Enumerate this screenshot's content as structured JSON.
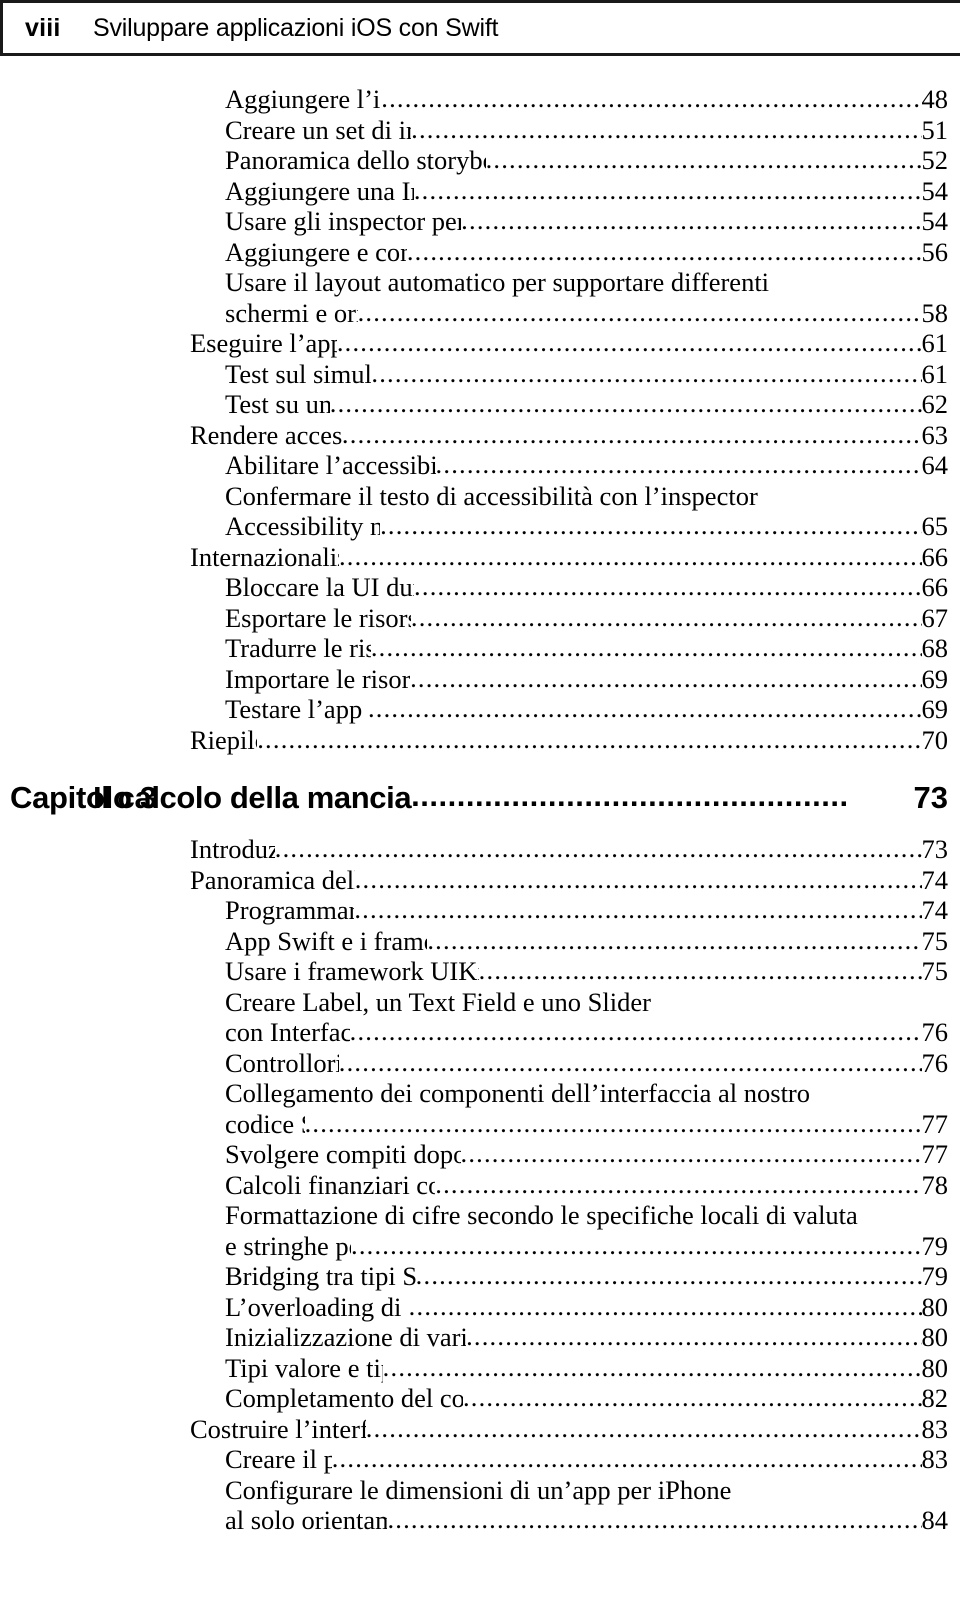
{
  "header": {
    "folio": "viii",
    "running_title": "Sviluppare applicazioni iOS con Swift"
  },
  "leader": "....................................................................................................................................",
  "toc": {
    "entries": [
      {
        "level": 2,
        "label": "Aggiungere l’icona dell’app",
        "page": "48"
      },
      {
        "level": 2,
        "label": "Creare un set di immagini per l’app",
        "page": "51"
      },
      {
        "level": 2,
        "label": "Panoramica dello storyboard e dell’area Utilities di Xcode",
        "page": "52"
      },
      {
        "level": 2,
        "label": "Aggiungere una Image View alla UI",
        "page": "54"
      },
      {
        "level": 2,
        "label": "Usare gli inspector per configurare la Image View",
        "page": "54"
      },
      {
        "level": 2,
        "label": "Aggiungere e configurare la Label",
        "page": "56"
      },
      {
        "level": 2,
        "label": "Usare il layout automatico per supportare differenti",
        "page": ""
      },
      {
        "level": 2,
        "label": "schermi e orientamenti",
        "page": "58"
      },
      {
        "level": 1,
        "label": "Eseguire l’app Welcome",
        "page": "61"
      },
      {
        "level": 2,
        "label": "Test sul simulatore di iOS",
        "page": "61"
      },
      {
        "level": 2,
        "label": "Test su un device",
        "page": "62"
      },
      {
        "level": 1,
        "label": "Rendere accessibile l’app",
        "page": "63"
      },
      {
        "level": 2,
        "label": "Abilitare l’accessibilità per la Image View",
        "page": "64"
      },
      {
        "level": 2,
        "label": "Confermare il testo di accessibilità con l’inspector",
        "page": ""
      },
      {
        "level": 2,
        "label": "Accessibility nel simulatore",
        "page": "65"
      },
      {
        "level": 1,
        "label": "Internazionalizzare l’app",
        "page": "66"
      },
      {
        "level": 2,
        "label": "Bloccare la UI durante la traduzione",
        "page": "66"
      },
      {
        "level": 2,
        "label": "Esportare le risorse stringa della UI",
        "page": "67"
      },
      {
        "level": 2,
        "label": "Tradurre le risorse stringa",
        "page": "68"
      },
      {
        "level": 2,
        "label": "Importare le risorse stringa tradotte",
        "page": "69"
      },
      {
        "level": 2,
        "label": "Testare l’app in spagnolo",
        "page": "69"
      },
      {
        "level": 1,
        "label": "Riepilogo",
        "page": "70"
      }
    ]
  },
  "chapter": {
    "number_label": "Capitolo 3",
    "title": "Il calcolo della mancia",
    "page": "73",
    "leader": "................................................"
  },
  "toc2": {
    "entries": [
      {
        "level": 1,
        "label": "Introduzione",
        "page": "73"
      },
      {
        "level": 1,
        "label": "Panoramica delle tecnologie",
        "page": "74"
      },
      {
        "level": 2,
        "label": "Programmare in Swift",
        "page": "74"
      },
      {
        "level": 2,
        "label": "App Swift e i framework Cocoa Touch",
        "sup": "®",
        "page": "75"
      },
      {
        "level": 2,
        "label": "Usare i framework UIKit e Foundation nel codice Swift",
        "page": "75"
      },
      {
        "level": 2,
        "label": "Creare Label, un Text Field e uno Slider",
        "page": ""
      },
      {
        "level": 2,
        "label": "con Interface Builder",
        "page": "76"
      },
      {
        "level": 2,
        "label": "Controllori di vista",
        "page": "76"
      },
      {
        "level": 2,
        "label": "Collegamento dei componenti dell’interfaccia al nostro",
        "page": ""
      },
      {
        "level": 2,
        "label": "codice Swift",
        "page": "77"
      },
      {
        "level": 2,
        "label": "Svolgere compiti dopo il caricamento di una vista",
        "page": "77"
      },
      {
        "level": 2,
        "label": "Calcoli finanziari con NSDecimalNumber",
        "page": "78"
      },
      {
        "level": 2,
        "label": "Formattazione di cifre secondo le specifiche locali di valuta",
        "page": ""
      },
      {
        "level": 2,
        "label": "e stringhe percentuali",
        "page": "79"
      },
      {
        "level": 2,
        "label": "Bridging tra tipi Swift e Objective-C",
        "page": "79"
      },
      {
        "level": 2,
        "label": "L’overloading di operatori in Swift",
        "page": "80"
      },
      {
        "level": 2,
        "label": "Inizializzazione di variabili e tipi opzionali di Swift",
        "page": "80"
      },
      {
        "level": 2,
        "label": "Tipi valore e tipi riferimento",
        "page": "80"
      },
      {
        "level": 2,
        "label": "Completamento del codice nell’editor del sorgente",
        "page": "82"
      },
      {
        "level": 1,
        "label": "Costruire l’interfaccia dell’app",
        "page": "83"
      },
      {
        "level": 2,
        "label": "Creare il progetto",
        "page": "83"
      },
      {
        "level": 2,
        "label": "Configurare le dimensioni di un’app per iPhone",
        "page": ""
      },
      {
        "level": 2,
        "label": "al solo orientamento verticale",
        "page": "84"
      }
    ]
  }
}
